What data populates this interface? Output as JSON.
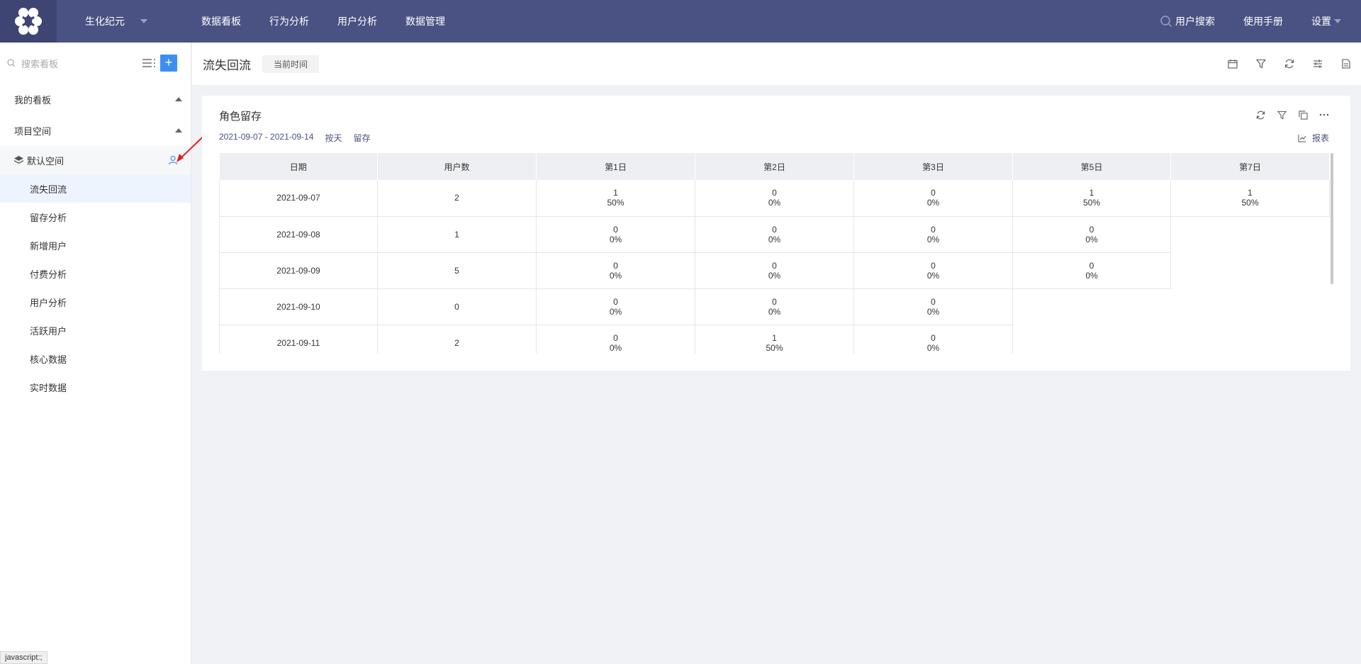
{
  "header": {
    "project": "生化纪元",
    "nav": [
      "数据看板",
      "行为分析",
      "用户分析",
      "数据管理"
    ],
    "user_search": "用户搜索",
    "manual": "使用手册",
    "settings": "设置"
  },
  "sidebar": {
    "search_placeholder": "搜索看板",
    "my_boards": "我的看板",
    "project_space": "项目空间",
    "default_space": "默认空间",
    "items": [
      "流失回流",
      "留存分析",
      "新增用户",
      "付费分析",
      "用户分析",
      "活跃用户",
      "核心数据",
      "实时数据"
    ],
    "active_item": "流失回流"
  },
  "page": {
    "title": "流失回流",
    "time_tag": "当前时间"
  },
  "card": {
    "title": "角色留存",
    "date_range": "2021-09-07 - 2021-09-14",
    "granularity": "按天",
    "metric": "留存",
    "report": "报表",
    "table": {
      "headers": [
        "日期",
        "用户数",
        "第1日",
        "第2日",
        "第3日",
        "第5日",
        "第7日"
      ],
      "rows": [
        {
          "date": "2021-09-07",
          "users": "2",
          "cells": [
            [
              "1",
              "50%"
            ],
            [
              "0",
              "0%"
            ],
            [
              "0",
              "0%"
            ],
            [
              "1",
              "50%"
            ],
            [
              "1",
              "50%"
            ]
          ]
        },
        {
          "date": "2021-09-08",
          "users": "1",
          "cells": [
            [
              "0",
              "0%"
            ],
            [
              "0",
              "0%"
            ],
            [
              "0",
              "0%"
            ],
            [
              "0",
              "0%"
            ]
          ]
        },
        {
          "date": "2021-09-09",
          "users": "5",
          "cells": [
            [
              "0",
              "0%"
            ],
            [
              "0",
              "0%"
            ],
            [
              "0",
              "0%"
            ],
            [
              "0",
              "0%"
            ]
          ]
        },
        {
          "date": "2021-09-10",
          "users": "0",
          "cells": [
            [
              "0",
              "0%"
            ],
            [
              "0",
              "0%"
            ],
            [
              "0",
              "0%"
            ]
          ]
        },
        {
          "date": "2021-09-11",
          "users": "2",
          "cells": [
            [
              "0",
              "0%"
            ],
            [
              "1",
              "50%"
            ],
            [
              "0",
              "0%"
            ]
          ]
        }
      ]
    }
  },
  "status_bar": "javascript:;",
  "colors": {
    "topbar": "#4a5283",
    "logo_bg": "#3e4572",
    "accent": "#3d8ef3",
    "annotation_arrow": "#e0201b"
  }
}
